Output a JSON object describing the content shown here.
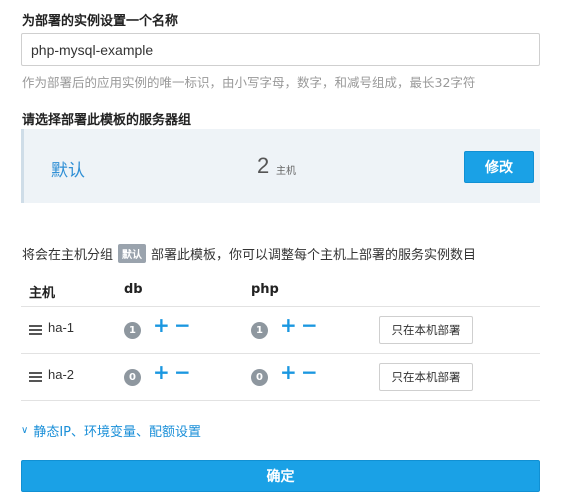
{
  "name_section": {
    "title": "为部署的实例设置一个名称",
    "input_value": "php-mysql-example",
    "hint": "作为部署后的应用实例的唯一标识，由小写字母，数字，和减号组成，最长32字符"
  },
  "server_group_section": {
    "title": "请选择部署此模板的服务器组",
    "group_name": "默认",
    "host_count": "2",
    "host_unit": "主机",
    "edit_label": "修改"
  },
  "deploy_info": {
    "prefix": "将会在主机分组",
    "group_tag": "默认",
    "suffix": "部署此模板，你可以调整每个主机上部署的服务实例数目"
  },
  "table": {
    "headers": [
      "主机",
      "db",
      "php"
    ],
    "rows": [
      {
        "host": "ha-1",
        "db": "1",
        "php": "1",
        "action": "只在本机部署"
      },
      {
        "host": "ha-2",
        "db": "0",
        "php": "0",
        "action": "只在本机部署"
      }
    ],
    "plus": "+",
    "minus": "−"
  },
  "advanced_link": "静态IP、环境变量、配额设置",
  "confirm_label": "确定",
  "colors": {
    "accent": "#1aa1e6",
    "link": "#1a8fd8",
    "panel_bg": "#eef3f7",
    "badge": "#8e979f"
  },
  "icons": {
    "host": "server-icon",
    "expand": "chevron-down-icon"
  }
}
